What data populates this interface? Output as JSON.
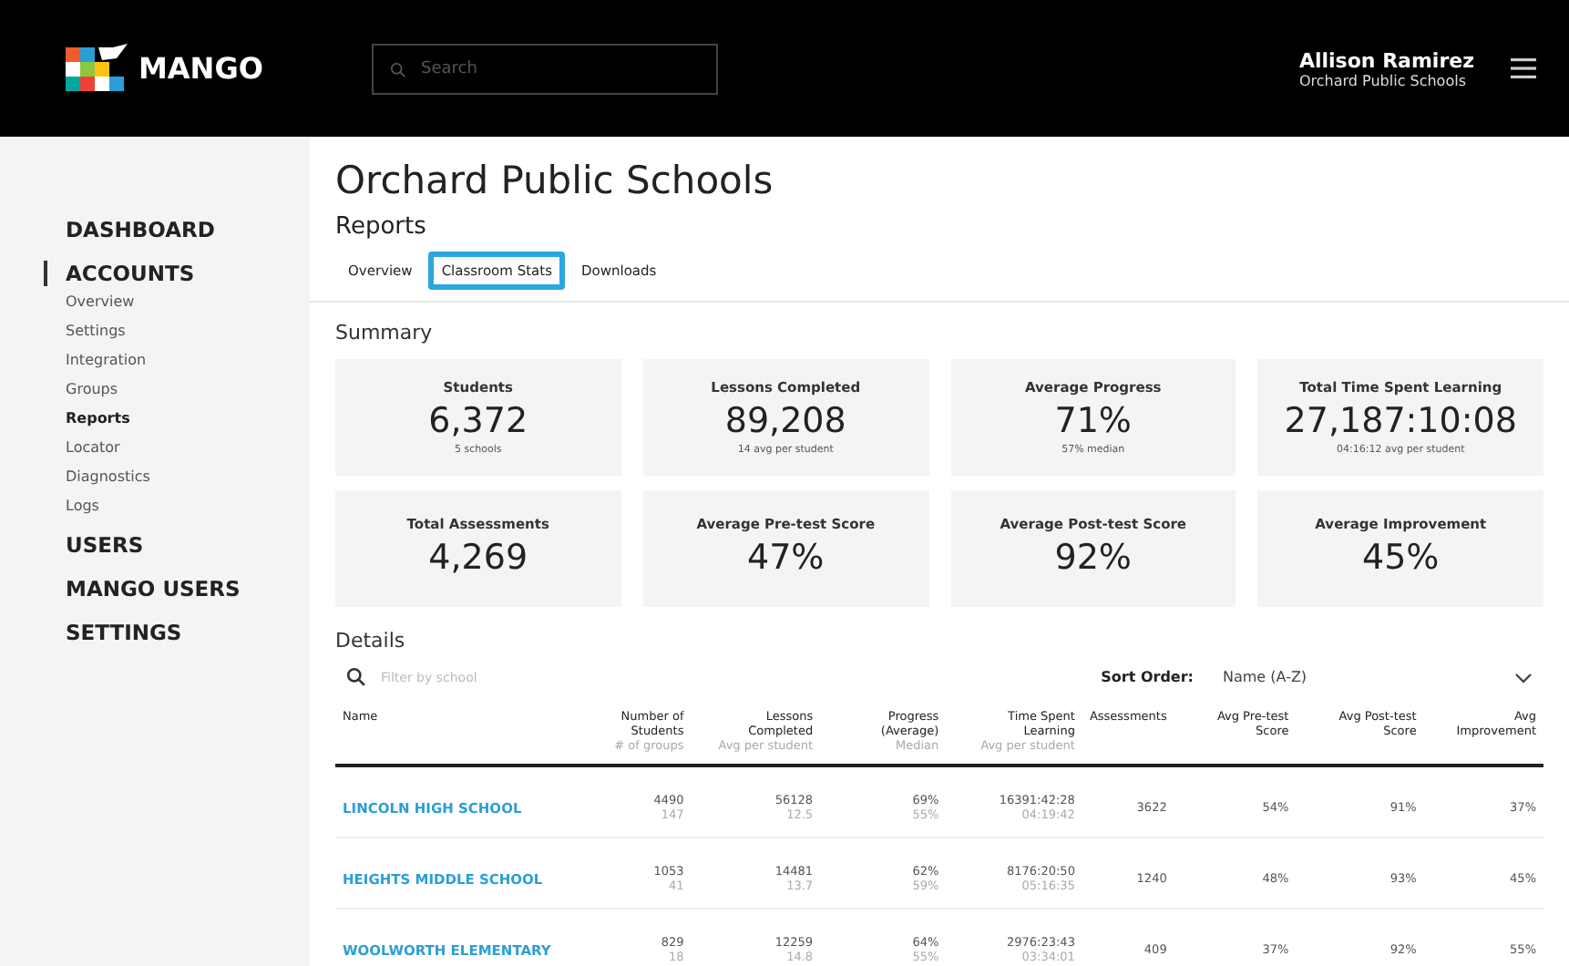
{
  "header": {
    "logo": "MANGO",
    "search": {
      "placeholder": "Search"
    },
    "user": {
      "name": "Allison Ramirez",
      "org": "Orchard Public Schools"
    }
  },
  "sidebar": {
    "sections": [
      {
        "label": "DASHBOARD",
        "selected": false
      },
      {
        "label": "ACCOUNTS",
        "selected": true,
        "children": [
          {
            "label": "Overview",
            "selected": false
          },
          {
            "label": "Settings",
            "selected": false
          },
          {
            "label": "Integration",
            "selected": false
          },
          {
            "label": "Groups",
            "selected": false
          },
          {
            "label": "Reports",
            "selected": true
          },
          {
            "label": "Locator",
            "selected": false
          },
          {
            "label": "Diagnostics",
            "selected": false
          },
          {
            "label": "Logs",
            "selected": false
          }
        ]
      },
      {
        "label": "USERS",
        "selected": false
      },
      {
        "label": "MANGO USERS",
        "selected": false
      },
      {
        "label": "SETTINGS",
        "selected": false
      }
    ]
  },
  "page": {
    "title": "Orchard Public Schools",
    "subtitle": "Reports"
  },
  "tabs": [
    {
      "label": "Overview",
      "selected": false
    },
    {
      "label": "Classroom Stats",
      "selected": true
    },
    {
      "label": "Downloads",
      "selected": false
    }
  ],
  "summary": {
    "heading": "Summary",
    "cards": [
      {
        "label": "Students",
        "value": "6,372",
        "note": "5 schools"
      },
      {
        "label": "Lessons Completed",
        "value": "89,208",
        "note": "14 avg per student"
      },
      {
        "label": "Average Progress",
        "value": "71%",
        "note": "57% median"
      },
      {
        "label": "Total Time Spent Learning",
        "value": "27,187:10:08",
        "note": "04:16:12 avg per student"
      },
      {
        "label": "Total Assessments",
        "value": "4,269"
      },
      {
        "label": "Average Pre-test Score",
        "value": "47%"
      },
      {
        "label": "Average Post-test Score",
        "value": "92%"
      },
      {
        "label": "Average Improvement",
        "value": "45%"
      }
    ]
  },
  "details": {
    "heading": "Details",
    "filter": {
      "placeholder": "Filter by school"
    },
    "sort": {
      "label": "Sort Order:",
      "value": "Name (A-Z)"
    },
    "table": {
      "columns": [
        {
          "label": "Name"
        },
        {
          "label": "Number of Students",
          "sub": "# of groups"
        },
        {
          "label": "Lessons Completed",
          "sub": "Avg per student"
        },
        {
          "label": "Progress (Average)",
          "sub": "Median"
        },
        {
          "label": "Time Spent Learning",
          "sub": "Avg per student"
        },
        {
          "label": "Assessments"
        },
        {
          "label": "Avg Pre-test Score"
        },
        {
          "label": "Avg Post-test Score"
        },
        {
          "label": "Avg Improvement"
        }
      ],
      "rows": [
        {
          "cells": [
            {
              "v": "LINCOLN HIGH SCHOOL"
            },
            {
              "v": "4490",
              "s": "147"
            },
            {
              "v": "56128",
              "s": "12.5"
            },
            {
              "v": "69%",
              "s": "55%"
            },
            {
              "v": "16391:42:28",
              "s": "04:19:42"
            },
            {
              "v": "3622"
            },
            {
              "v": "54%"
            },
            {
              "v": "91%"
            },
            {
              "v": "37%"
            }
          ]
        },
        {
          "cells": [
            {
              "v": "HEIGHTS MIDDLE SCHOOL"
            },
            {
              "v": "1053",
              "s": "41"
            },
            {
              "v": "14481",
              "s": "13.7"
            },
            {
              "v": "62%",
              "s": "59%"
            },
            {
              "v": "8176:20:50",
              "s": "05:16:35"
            },
            {
              "v": "1240"
            },
            {
              "v": "48%"
            },
            {
              "v": "93%"
            },
            {
              "v": "45%"
            }
          ]
        },
        {
          "cells": [
            {
              "v": "WOOLWORTH ELEMENTARY"
            },
            {
              "v": "829",
              "s": "18"
            },
            {
              "v": "12259",
              "s": "14.8"
            },
            {
              "v": "64%",
              "s": "55%"
            },
            {
              "v": "2976:23:43",
              "s": "03:34:01"
            },
            {
              "v": "409"
            },
            {
              "v": "37%"
            },
            {
              "v": "92%"
            },
            {
              "v": "55%"
            }
          ]
        }
      ]
    }
  }
}
